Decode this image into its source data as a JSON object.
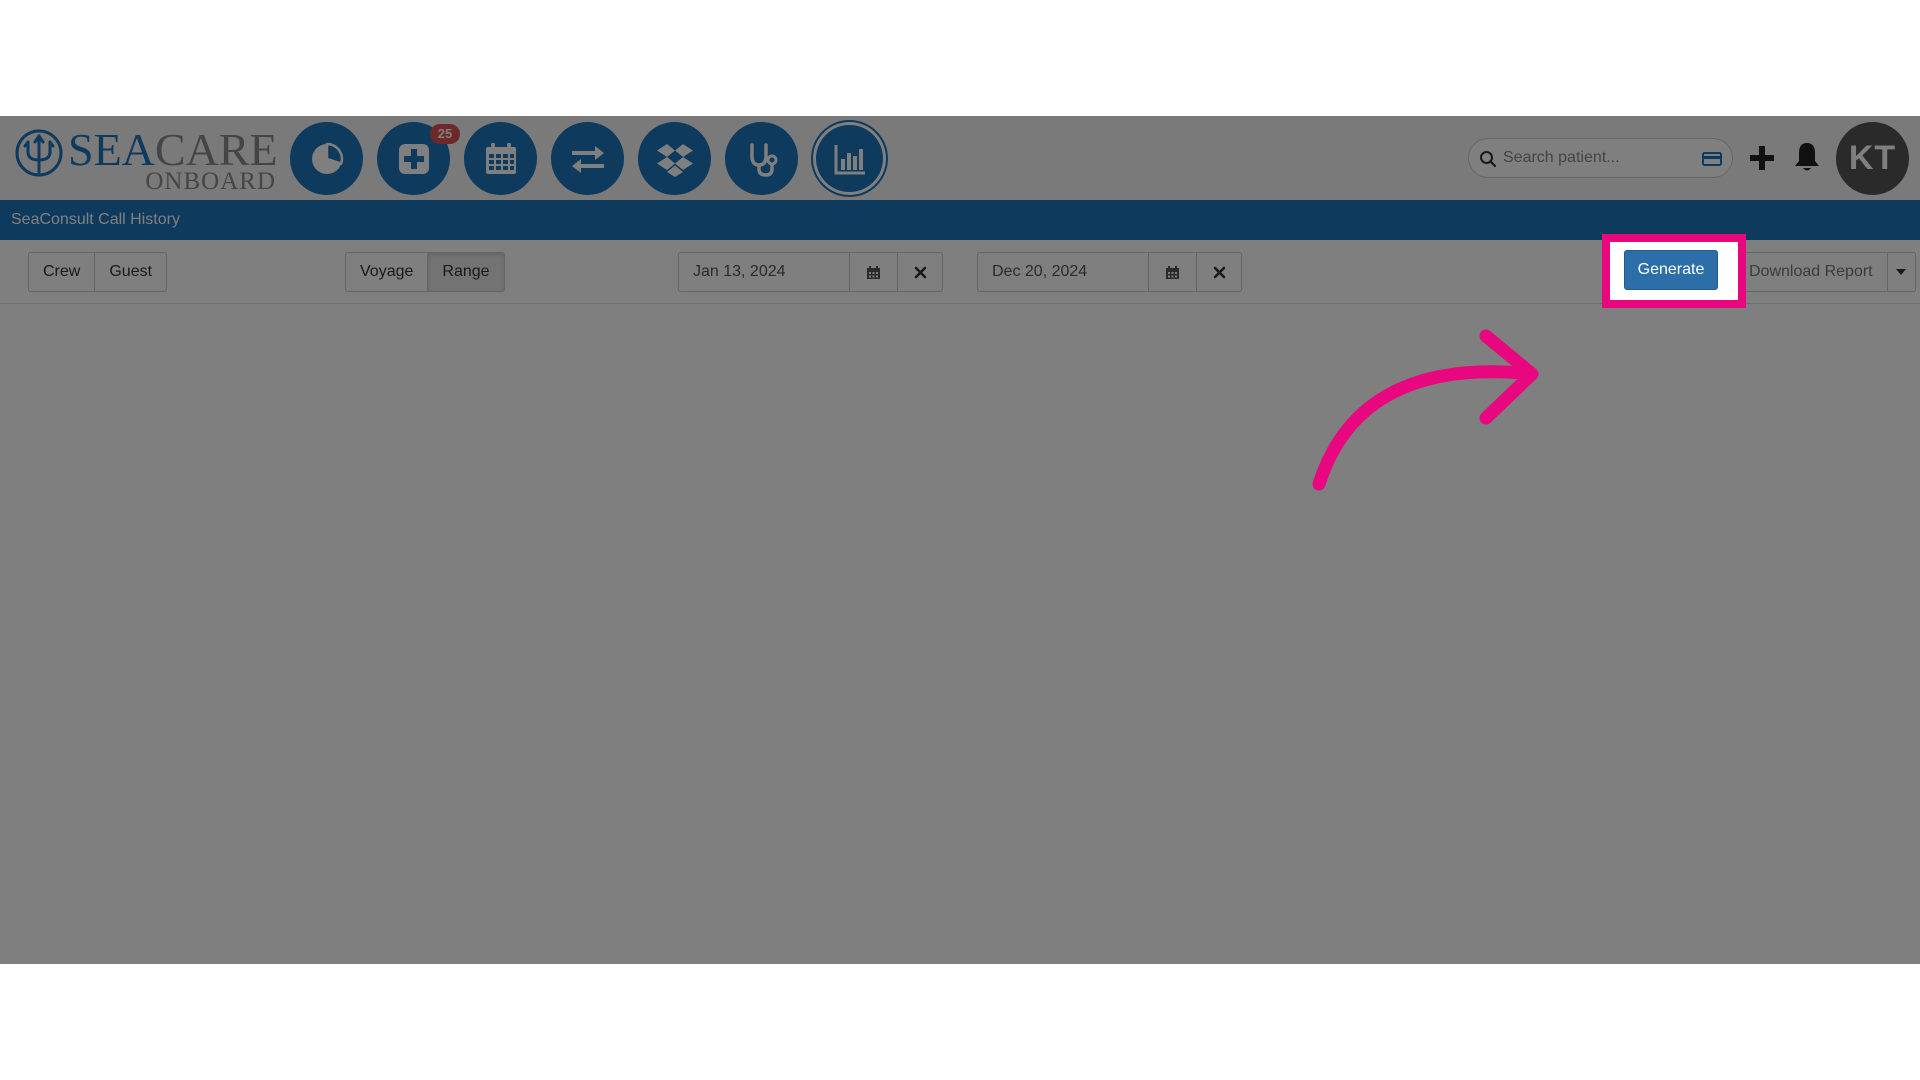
{
  "app": {
    "logo_primary": "SEA",
    "logo_secondary": "CARE",
    "logo_sub": "ONBOARD"
  },
  "nav": {
    "items": [
      {
        "name": "dashboard",
        "icon": "pie-chart-icon"
      },
      {
        "name": "medical",
        "icon": "medical-plus-icon",
        "badge": "25"
      },
      {
        "name": "calendar",
        "icon": "calendar-icon"
      },
      {
        "name": "transfer",
        "icon": "exchange-icon"
      },
      {
        "name": "dropbox",
        "icon": "dropbox-icon"
      },
      {
        "name": "consult",
        "icon": "stethoscope-icon"
      },
      {
        "name": "reports",
        "icon": "bar-chart-icon",
        "active": true
      }
    ]
  },
  "search": {
    "placeholder": "Search patient..."
  },
  "user": {
    "initials": "KT"
  },
  "page": {
    "title": "SeaConsult Call History"
  },
  "toolbar": {
    "person_type": {
      "options": [
        "Crew",
        "Guest"
      ]
    },
    "period_type": {
      "options": [
        "Voyage",
        "Range"
      ],
      "selected": "Range"
    },
    "start_date": "Jan 13, 2024",
    "end_date": "Dec 20, 2024",
    "generate_label": "Generate",
    "download_label": "Download Report"
  },
  "colors": {
    "brand_blue": "#1b75bb",
    "highlight_pink": "#e8077f",
    "generate_blue": "#2c6ea8"
  }
}
